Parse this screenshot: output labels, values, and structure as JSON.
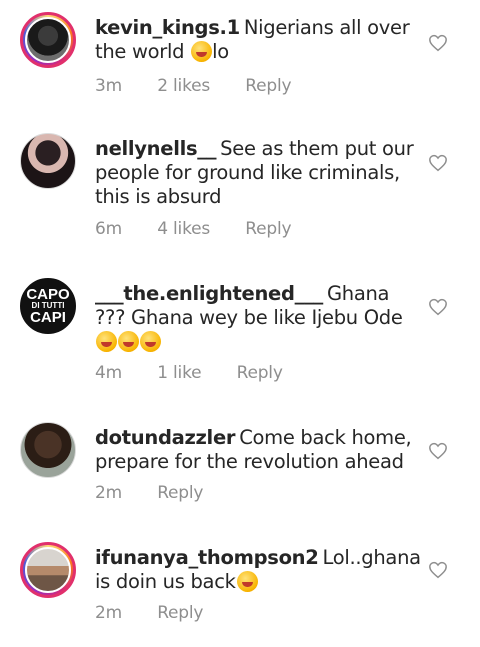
{
  "comments": [
    {
      "username": "kevin_kings.1",
      "body": "Nigerians all over the world",
      "tail": "lo",
      "time": "3m",
      "likes": "2 likes",
      "reply": "Reply"
    },
    {
      "username": "nellynells__",
      "body": "See as them put our people for ground like criminals, this is absurd",
      "time": "6m",
      "likes": "4 likes",
      "reply": "Reply"
    },
    {
      "username": "___the.enlightened___",
      "body": "Ghana ??? Ghana wey be like Ijebu Ode",
      "time": "4m",
      "likes": "1 like",
      "reply": "Reply",
      "avatar_text": [
        "CAPO",
        "DI TUTTI",
        "CAPI"
      ]
    },
    {
      "username": "dotundazzler",
      "body": "Come back home, prepare for the revolution ahead",
      "time": "2m",
      "reply": "Reply"
    },
    {
      "username": "ifunanya_thompson2",
      "body": "Lol..ghana is doin us back",
      "time": "2m",
      "reply": "Reply"
    }
  ],
  "icons": {
    "like": "heart-outline-icon"
  },
  "colors": {
    "text": "#262626",
    "meta": "#8e8e8e",
    "heart_stroke": "#8e8e8e"
  }
}
